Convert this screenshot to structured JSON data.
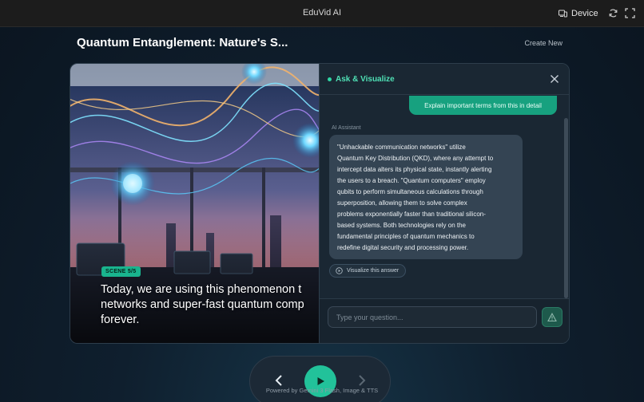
{
  "app": {
    "title": "EduVid AI"
  },
  "topbar": {
    "device_label": "Device",
    "device_icon": "device-icon",
    "refresh_icon": "refresh-icon",
    "fullscreen_icon": "fullscreen-icon"
  },
  "header": {
    "title": "Quantum Entanglement: Nature's S...",
    "create_new": "Create New"
  },
  "scene": {
    "badge": "SCENE 5/5",
    "caption_lines": [
      "Today, we are using this phenomenon t",
      "networks and super-fast quantum comp",
      "forever."
    ]
  },
  "chat": {
    "title": "Ask & Visualize",
    "user_message": "Explain important terms from this in detail",
    "assistant_label": "AI Assistant",
    "assistant_lines": [
      "\"Unhackable communication networks\" utilize",
      "Quantum Key Distribution (QKD), where any attempt to",
      "intercept data alters its physical state, instantly alerting",
      "the users to a breach. \"Quantum computers\" employ",
      "qubits to perform simultaneous calculations through",
      "superposition, allowing them to solve complex",
      "problems exponentially faster than traditional silicon-",
      "based systems. Both technologies rely on the",
      "fundamental principles of quantum mechanics to",
      "redefine digital security and processing power."
    ],
    "visualize_label": "Visualize this answer",
    "input_placeholder": "Type your question..."
  },
  "footer": {
    "powered_by": "Powered by Gemini 3 Flash, Image & TTS"
  },
  "colors": {
    "accent": "#22c29a",
    "accent_text": "#4fe0b5",
    "user_bubble": "#17a17f",
    "assistant_bubble": "#344453"
  }
}
